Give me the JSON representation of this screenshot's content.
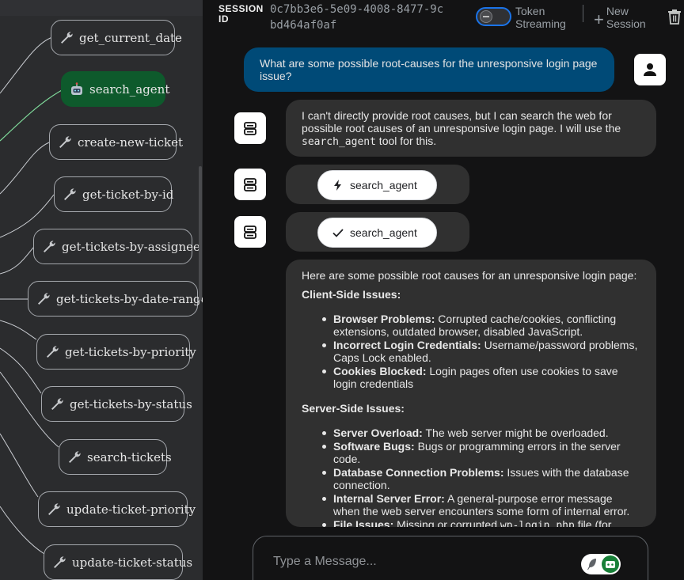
{
  "graph": {
    "nodes": [
      {
        "label": "get_current_date",
        "icon": "wrench-icon",
        "active": false
      },
      {
        "label": "search_agent",
        "icon": "robot-icon",
        "active": true
      },
      {
        "label": "create-new-ticket",
        "icon": "wrench-icon",
        "active": false
      },
      {
        "label": "get-ticket-by-id",
        "icon": "wrench-icon",
        "active": false
      },
      {
        "label": "get-tickets-by-assignee",
        "icon": "wrench-icon",
        "active": false
      },
      {
        "label": "get-tickets-by-date-range",
        "icon": "wrench-icon",
        "active": false
      },
      {
        "label": "get-tickets-by-priority",
        "icon": "wrench-icon",
        "active": false
      },
      {
        "label": "get-tickets-by-status",
        "icon": "wrench-icon",
        "active": false
      },
      {
        "label": "search-tickets",
        "icon": "wrench-icon",
        "active": false
      },
      {
        "label": "update-ticket-priority",
        "icon": "wrench-icon",
        "active": false
      },
      {
        "label": "update-ticket-status",
        "icon": "wrench-icon",
        "active": false
      }
    ],
    "colors": {
      "active_node": "#0e5a2c",
      "active_edge": "#7fd99a",
      "edge": "#c9ccd1"
    }
  },
  "header": {
    "session_label": "SESSION ID",
    "session_id": "0c7bb3e6-5e09-4008-8477-9cbd464af0af",
    "token_streaming_label": "Token Streaming",
    "token_streaming_on": false,
    "new_session_label": "New Session"
  },
  "messages": {
    "user_question": "What are some possible root-causes for the unresponsive login page issue?",
    "bot_intro_before": "I can't directly provide root causes, but I can search the web for possible root causes of an unresponsive login page. I will use the ",
    "bot_intro_code": "search_agent",
    "bot_intro_after": " tool for this.",
    "tool_call": {
      "name": "search_agent",
      "icon": "bolt-icon"
    },
    "tool_result": {
      "name": "search_agent",
      "icon": "check-icon"
    },
    "answer": {
      "intro": "Here are some possible root causes for an unresponsive login page:",
      "client_heading": "Client-Side Issues:",
      "client_items": [
        {
          "bold": "Browser Problems:",
          "text": " Corrupted cache/cookies, conflicting extensions, outdated browser, disabled JavaScript."
        },
        {
          "bold": "Incorrect Login Credentials:",
          "text": " Username/password problems, Caps Lock enabled."
        },
        {
          "bold": "Cookies Blocked:",
          "text": " Login pages often use cookies to save login credentials"
        }
      ],
      "server_heading": "Server-Side Issues:",
      "server_items": [
        {
          "bold": "Server Overload:",
          "text": " The web server might be overloaded."
        },
        {
          "bold": "Software Bugs:",
          "text": " Bugs or programming errors in the server code."
        },
        {
          "bold": "Database Connection Problems:",
          "text": " Issues with the database connection."
        },
        {
          "bold": "Internal Server Error:",
          "text": " A general-purpose error message when the web server encounters some form of internal error."
        }
      ],
      "file_item_bold": "File Issues:",
      "file_item_text": " Missing or corrupted ",
      "file_item_code": "wp-login.php",
      "file_item_tail": " file (for"
    }
  },
  "composer": {
    "placeholder": "Type a Message..."
  }
}
